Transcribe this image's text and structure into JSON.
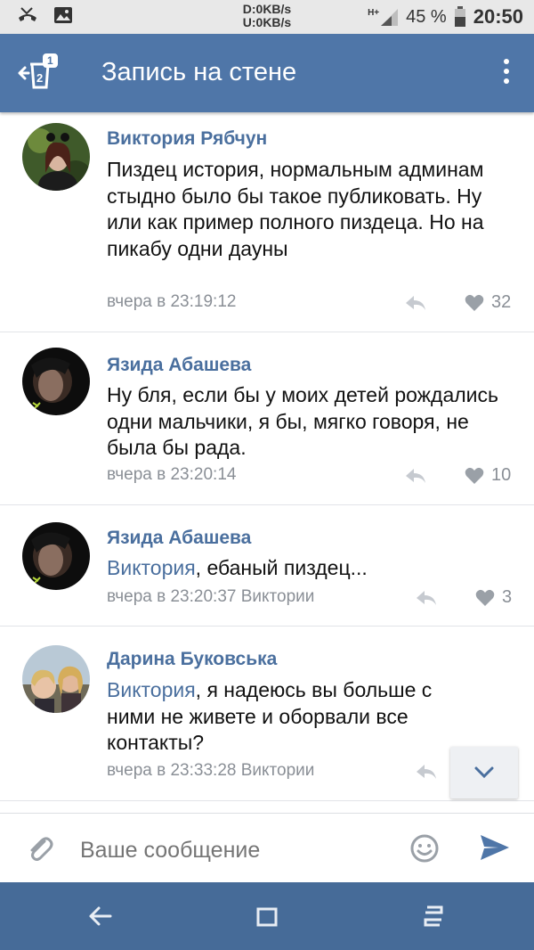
{
  "status_bar": {
    "download": "D:0KB/s",
    "upload": "U:0KB/s",
    "network": "H+",
    "battery": "45 %",
    "time": "20:50",
    "icons": [
      "missed-call-icon",
      "image-icon",
      "signal-icon",
      "battery-icon"
    ]
  },
  "header": {
    "title": "Запись на стене",
    "badge": "1",
    "accent": "#4f76a8"
  },
  "comments": [
    {
      "author": "Виктория Рябчун",
      "text": "Пиздец история, нормальным админам стыдно было бы такое публиковать. Ну или как пример полного пиздеца. Но на пикабу одни дауны",
      "time": "вчера в 23:19:12",
      "likes": "32"
    },
    {
      "author": "Язида Абашева",
      "text": "Ну бля, если бы у моих детей рождались одни мальчики, я бы, мягко говоря, не была бы рада.",
      "time": "вчера в 23:20:14",
      "likes": "10"
    },
    {
      "author": "Язида Абашева",
      "mention": "Виктория",
      "text": ", ебаный пиздец...",
      "time": "вчера в 23:20:37 Виктории",
      "likes": "3"
    },
    {
      "author": "Дарина Буковська",
      "mention": "Виктория",
      "text": ", я надеюсь вы больше с ними не живете и оборвали все контакты?",
      "time": "вчера в 23:33:28 Виктории"
    }
  ],
  "composer": {
    "placeholder": "Ваше сообщение"
  },
  "colors": {
    "link": "#4a6f9e",
    "navbar": "#466b98"
  }
}
